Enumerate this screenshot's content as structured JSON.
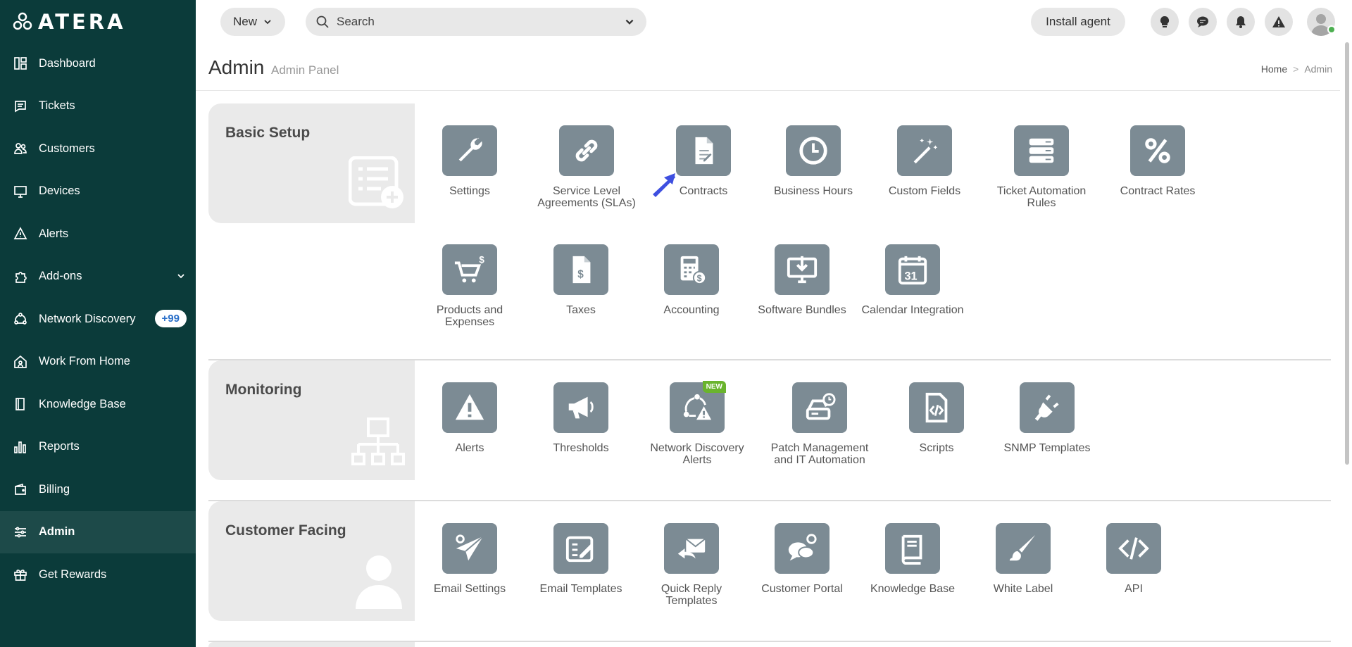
{
  "app": {
    "logo_text": "ATERA"
  },
  "sidebar": {
    "items": [
      {
        "label": "Dashboard",
        "icon": "dashboard-icon"
      },
      {
        "label": "Tickets",
        "icon": "tickets-icon"
      },
      {
        "label": "Customers",
        "icon": "customers-icon"
      },
      {
        "label": "Devices",
        "icon": "devices-icon"
      },
      {
        "label": "Alerts",
        "icon": "alerts-icon"
      },
      {
        "label": "Add-ons",
        "icon": "addons-icon"
      },
      {
        "label": "Network Discovery",
        "icon": "network-discovery-icon",
        "badge": "+99"
      },
      {
        "label": "Work From Home",
        "icon": "home-icon"
      },
      {
        "label": "Knowledge Base",
        "icon": "book-icon"
      },
      {
        "label": "Reports",
        "icon": "reports-icon"
      },
      {
        "label": "Billing",
        "icon": "wallet-icon"
      },
      {
        "label": "Admin",
        "icon": "sliders-icon",
        "active": true
      },
      {
        "label": "Get Rewards",
        "icon": "gift-icon"
      }
    ]
  },
  "topbar": {
    "new_label": "New",
    "search_placeholder": "Search",
    "install_label": "Install agent"
  },
  "header": {
    "title": "Admin",
    "subtitle": "Admin Panel",
    "breadcrumb": [
      "Home",
      "Admin"
    ]
  },
  "sections": {
    "basic_setup": {
      "title": "Basic Setup",
      "tiles": [
        "Settings",
        "Service Level Agreements (SLAs)",
        "Contracts",
        "Business Hours",
        "Custom Fields",
        "Ticket Automation Rules",
        "Contract Rates",
        "Products and Expenses",
        "Taxes",
        "Accounting",
        "Software Bundles",
        "Calendar Integration"
      ]
    },
    "monitoring": {
      "title": "Monitoring",
      "tiles": [
        "Alerts",
        "Thresholds",
        "Network Discovery Alerts",
        "Patch Management and IT Automation",
        "Scripts",
        "SNMP Templates"
      ],
      "new_badge": "NEW"
    },
    "customer_facing": {
      "title": "Customer Facing",
      "tiles": [
        "Email Settings",
        "Email Templates",
        "Quick Reply Templates",
        "Customer Portal",
        "Knowledge Base",
        "White Label",
        "API"
      ]
    }
  },
  "colors": {
    "sidebar_bg": "#0b3b3a",
    "tile_bg": "#7c8b94",
    "accent": "#2a6fc9",
    "new_badge": "#6ab42d"
  }
}
